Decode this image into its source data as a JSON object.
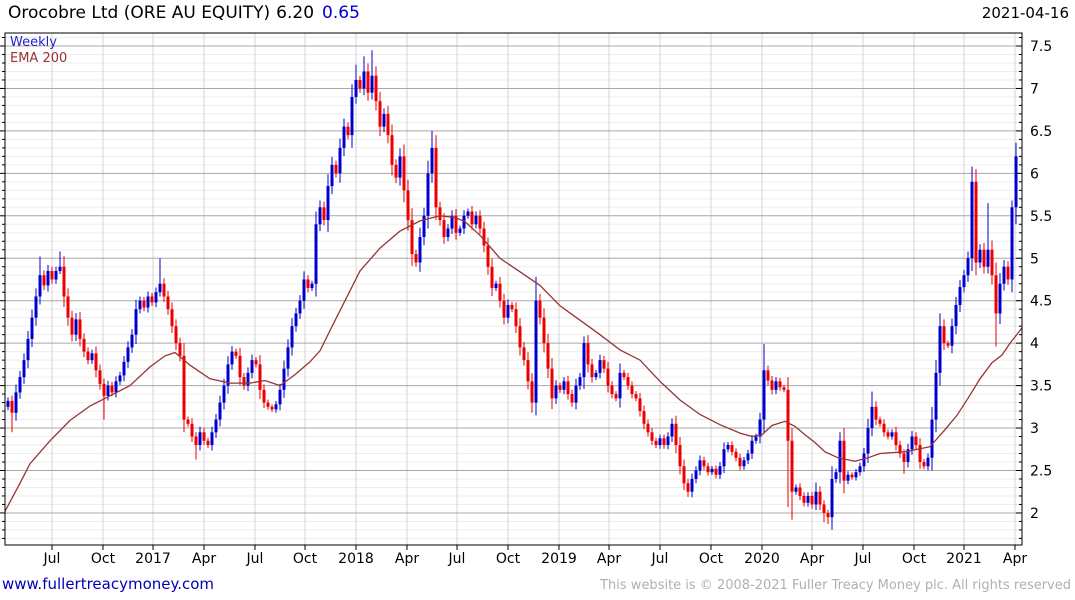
{
  "header": {
    "title": "Orocobre Ltd (ORE AU EQUITY)",
    "price": "6.20",
    "change": "0.65",
    "date": "2021-04-16"
  },
  "legend": {
    "series": "Weekly",
    "overlay": "EMA 200"
  },
  "footer": {
    "link": "www.fullertreacymoney.com",
    "copyright": "This website is © 2008-2021 Fuller Treacy Money plc. All rights reserved"
  },
  "colors": {
    "up": "#0000cc",
    "down": "#ee0000",
    "ema": "#993333",
    "legend_series": "#2222cc",
    "link": "#0000bb",
    "copyright": "#b0b0b0",
    "grid_major": "#a8a8a8",
    "grid_minor": "#ededed",
    "grid_vertical": "#d4d4d4",
    "frame": "#000000",
    "label": "#000000"
  },
  "chart_data": {
    "type": "candlestick",
    "period": "weekly",
    "title": "Orocobre Ltd (ORE AU EQUITY) weekly candles with EMA 200",
    "y_axis": {
      "tick_values": [
        7.5,
        7.0,
        6.5,
        6.0,
        5.5,
        5.0,
        4.5,
        4.0,
        3.5,
        3.0,
        2.5,
        2.0
      ],
      "minor_step": 0.1,
      "range_shown": [
        1.62,
        7.65
      ]
    },
    "x_axis": {
      "tick_labels": [
        "Jul",
        "Oct",
        "2017",
        "Apr",
        "Jul",
        "Oct",
        "2018",
        "Apr",
        "Jul",
        "Oct",
        "2019",
        "Apr",
        "Jul",
        "Oct",
        "2020",
        "Apr",
        "Jul",
        "Oct",
        "2021",
        "Apr"
      ]
    },
    "open_first": 3.25,
    "closes": [
      3.32,
      3.18,
      3.42,
      3.6,
      3.8,
      4.05,
      4.3,
      4.55,
      4.8,
      4.68,
      4.85,
      4.75,
      4.85,
      4.9,
      4.55,
      4.3,
      4.1,
      4.28,
      4.05,
      3.9,
      3.8,
      3.88,
      3.68,
      3.52,
      3.38,
      3.5,
      3.42,
      3.55,
      3.62,
      3.78,
      3.95,
      4.1,
      4.4,
      4.5,
      4.42,
      4.55,
      4.48,
      4.6,
      4.7,
      4.55,
      4.4,
      4.2,
      4.0,
      3.85,
      3.1,
      3.05,
      2.9,
      2.8,
      2.95,
      2.85,
      2.8,
      2.95,
      3.1,
      3.3,
      3.5,
      3.75,
      3.9,
      3.85,
      3.6,
      3.5,
      3.65,
      3.8,
      3.75,
      3.45,
      3.3,
      3.25,
      3.22,
      3.28,
      3.45,
      3.7,
      3.95,
      4.2,
      4.35,
      4.5,
      4.75,
      4.65,
      4.7,
      5.4,
      5.6,
      5.45,
      5.85,
      6.1,
      6.0,
      6.3,
      6.55,
      6.45,
      6.9,
      7.1,
      7.0,
      7.2,
      6.95,
      7.15,
      6.85,
      6.55,
      6.7,
      6.45,
      6.1,
      5.95,
      6.2,
      5.8,
      5.45,
      5.05,
      4.95,
      5.25,
      5.5,
      6.0,
      6.3,
      5.6,
      5.45,
      5.25,
      5.35,
      5.5,
      5.3,
      5.35,
      5.5,
      5.55,
      5.4,
      5.5,
      5.35,
      5.15,
      4.9,
      4.65,
      4.7,
      4.5,
      4.3,
      4.45,
      4.4,
      4.2,
      3.95,
      3.8,
      3.55,
      3.3,
      4.5,
      4.3,
      4.0,
      3.7,
      3.35,
      3.5,
      3.45,
      3.55,
      3.4,
      3.3,
      3.5,
      3.6,
      4.0,
      3.75,
      3.6,
      3.65,
      3.8,
      3.7,
      3.5,
      3.4,
      3.35,
      3.65,
      3.6,
      3.5,
      3.4,
      3.35,
      3.2,
      3.05,
      2.95,
      2.85,
      2.8,
      2.88,
      2.8,
      2.9,
      3.05,
      2.8,
      2.55,
      2.35,
      2.25,
      2.4,
      2.5,
      2.62,
      2.55,
      2.48,
      2.52,
      2.45,
      2.55,
      2.75,
      2.8,
      2.72,
      2.65,
      2.55,
      2.62,
      2.7,
      2.85,
      2.9,
      3.1,
      3.68,
      3.56,
      3.45,
      3.55,
      3.48,
      3.45,
      2.85,
      2.25,
      2.3,
      2.2,
      2.12,
      2.2,
      2.1,
      2.25,
      2.1,
      2.0,
      1.95,
      2.4,
      2.48,
      2.85,
      2.38,
      2.45,
      2.42,
      2.48,
      2.55,
      2.7,
      3.0,
      3.25,
      3.1,
      3.05,
      2.95,
      2.9,
      2.95,
      2.8,
      2.7,
      2.6,
      2.75,
      2.9,
      2.8,
      2.6,
      2.55,
      2.65,
      3.1,
      3.65,
      4.2,
      4.0,
      3.97,
      4.2,
      4.45,
      4.66,
      4.8,
      5.0,
      5.9,
      4.95,
      5.1,
      4.9,
      5.1,
      4.8,
      4.35,
      4.7,
      4.9,
      4.75,
      5.6,
      6.2
    ],
    "wick_overrides": {
      "highs": {
        "8": 5.02,
        "13": 5.08,
        "38": 5.0,
        "87": 7.28,
        "89": 7.38,
        "91": 7.45,
        "106": 6.5,
        "132": 4.78,
        "144": 4.08,
        "189": 3.99,
        "202": 2.36,
        "208": 2.95,
        "216": 3.43,
        "241": 6.08,
        "245": 5.65,
        "251": 5.68,
        "252": 6.36
      },
      "lows": {
        "1": 2.95,
        "24": 3.1,
        "47": 2.63,
        "131": 3.18,
        "170": 2.19,
        "195": 2.07,
        "196": 1.92,
        "204": 1.89,
        "205": 1.87,
        "224": 2.46,
        "247": 3.96,
        "252": 5.4
      }
    },
    "ema": {
      "name": "EMA 200",
      "points": [
        [
          5,
          2.02
        ],
        [
          20,
          2.35
        ],
        [
          30,
          2.58
        ],
        [
          50,
          2.85
        ],
        [
          70,
          3.09
        ],
        [
          90,
          3.26
        ],
        [
          110,
          3.38
        ],
        [
          130,
          3.5
        ],
        [
          150,
          3.72
        ],
        [
          165,
          3.85
        ],
        [
          175,
          3.89
        ],
        [
          190,
          3.74
        ],
        [
          210,
          3.58
        ],
        [
          230,
          3.53
        ],
        [
          250,
          3.53
        ],
        [
          265,
          3.56
        ],
        [
          280,
          3.5
        ],
        [
          295,
          3.63
        ],
        [
          310,
          3.78
        ],
        [
          320,
          3.91
        ],
        [
          333,
          4.22
        ],
        [
          345,
          4.5
        ],
        [
          360,
          4.85
        ],
        [
          380,
          5.12
        ],
        [
          400,
          5.32
        ],
        [
          420,
          5.44
        ],
        [
          440,
          5.5
        ],
        [
          455,
          5.48
        ],
        [
          465,
          5.43
        ],
        [
          480,
          5.27
        ],
        [
          500,
          5.0
        ],
        [
          520,
          4.84
        ],
        [
          540,
          4.68
        ],
        [
          560,
          4.44
        ],
        [
          580,
          4.27
        ],
        [
          600,
          4.1
        ],
        [
          620,
          3.92
        ],
        [
          640,
          3.8
        ],
        [
          660,
          3.55
        ],
        [
          680,
          3.33
        ],
        [
          700,
          3.16
        ],
        [
          720,
          3.04
        ],
        [
          740,
          2.94
        ],
        [
          752,
          2.9
        ],
        [
          762,
          2.92
        ],
        [
          772,
          3.03
        ],
        [
          785,
          3.08
        ],
        [
          795,
          3.02
        ],
        [
          805,
          2.92
        ],
        [
          815,
          2.83
        ],
        [
          825,
          2.72
        ],
        [
          838,
          2.65
        ],
        [
          855,
          2.61
        ],
        [
          868,
          2.65
        ],
        [
          880,
          2.7
        ],
        [
          905,
          2.72
        ],
        [
          930,
          2.78
        ],
        [
          945,
          2.98
        ],
        [
          957,
          3.15
        ],
        [
          968,
          3.35
        ],
        [
          980,
          3.58
        ],
        [
          992,
          3.77
        ],
        [
          1002,
          3.86
        ],
        [
          1010,
          4.0
        ],
        [
          1022,
          4.18
        ]
      ]
    }
  }
}
